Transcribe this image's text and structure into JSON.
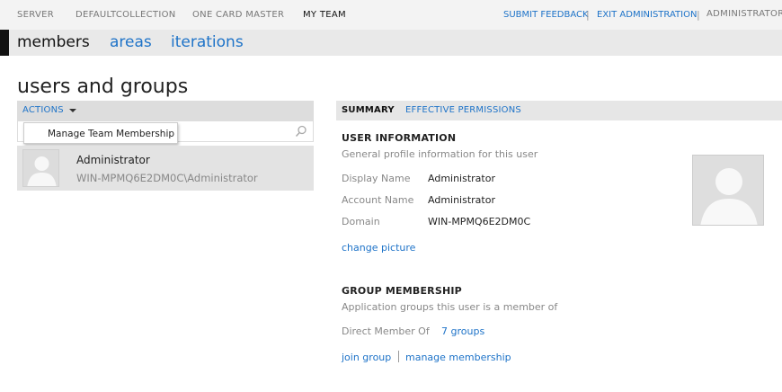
{
  "topnav": {
    "items": [
      "SERVER",
      "DEFAULTCOLLECTION",
      "ONE CARD MASTER",
      "MY TEAM"
    ],
    "submit_feedback": "SUBMIT FEEDBACK",
    "exit_admin": "EXIT ADMINISTRATION",
    "user": "ADMINISTRATOR",
    "separator": "|"
  },
  "tabs": [
    "members",
    "areas",
    "iterations"
  ],
  "page_title": "users and groups",
  "actions": {
    "label": "ACTIONS",
    "menu_item": "Manage Team Membership"
  },
  "user_row": {
    "name": "Administrator",
    "account": "WIN-MPMQ6E2DM0C\\Administrator"
  },
  "right_tabs": {
    "summary": "SUMMARY",
    "effective": "EFFECTIVE PERMISSIONS"
  },
  "user_info": {
    "title": "USER INFORMATION",
    "subtitle": "General profile information for this user",
    "display_name_label": "Display Name",
    "display_name": "Administrator",
    "account_name_label": "Account Name",
    "account_name": "Administrator",
    "domain_label": "Domain",
    "domain": "WIN-MPMQ6E2DM0C",
    "change_picture": "change picture"
  },
  "group_membership": {
    "title": "GROUP MEMBERSHIP",
    "subtitle": "Application groups this user is a member of",
    "direct_label": "Direct Member Of",
    "direct_value": "7 groups",
    "join_group": "join group",
    "manage_membership": "manage membership"
  },
  "colors": {
    "link": "#1e73c8",
    "bar": "#e9e9e9"
  }
}
